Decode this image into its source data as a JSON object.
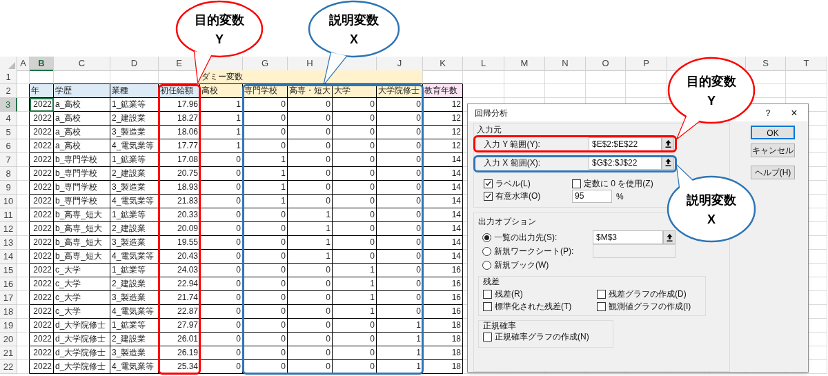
{
  "sheet": {
    "columns": [
      {
        "label": "A",
        "selected": false
      },
      {
        "label": "B",
        "selected": true
      },
      {
        "label": "C",
        "selected": false
      },
      {
        "label": "D",
        "selected": false
      },
      {
        "label": "E",
        "selected": false
      },
      {
        "selected": false
      },
      {
        "label": "G",
        "selected": false
      },
      {
        "label": "H",
        "selected": false
      },
      {
        "selected": false
      },
      {
        "label": "J",
        "selected": false
      },
      {
        "label": "K",
        "selected": false
      },
      {
        "label": "L",
        "selected": false
      },
      {
        "label": "M",
        "selected": false
      },
      {
        "label": "N",
        "selected": false
      },
      {
        "label": "O",
        "selected": false
      },
      {
        "label": "P",
        "selected": false
      },
      {
        "selected": false
      },
      {
        "selected": false
      },
      {
        "label": "S",
        "selected": false
      },
      {
        "label": "T",
        "selected": false
      }
    ],
    "rows": [
      {
        "number": "1",
        "selected": false
      },
      {
        "number": "2",
        "selected": false
      },
      {
        "number": "3",
        "selected": true
      },
      {
        "number": "4",
        "selected": false
      },
      {
        "number": "5",
        "selected": false
      },
      {
        "number": "6",
        "selected": false
      },
      {
        "number": "7",
        "selected": false
      },
      {
        "number": "8",
        "selected": false
      },
      {
        "number": "9",
        "selected": false
      },
      {
        "number": "10",
        "selected": false
      },
      {
        "number": "11",
        "selected": false
      },
      {
        "number": "12",
        "selected": false
      },
      {
        "number": "13",
        "selected": false
      },
      {
        "number": "14",
        "selected": false
      },
      {
        "number": "15",
        "selected": false
      },
      {
        "number": "16",
        "selected": false
      },
      {
        "number": "17",
        "selected": false
      },
      {
        "number": "18",
        "selected": false
      },
      {
        "number": "19",
        "selected": false
      },
      {
        "number": "20",
        "selected": false
      },
      {
        "number": "21",
        "selected": false
      },
      {
        "number": "22",
        "selected": false
      }
    ],
    "group_header": {
      "text": "ダミー変数",
      "color": "#fff2cc"
    },
    "headers": [
      {
        "text": "年",
        "color": "#ddebf7"
      },
      {
        "text": "学歴",
        "color": "#ddebf7"
      },
      {
        "text": "業種",
        "color": "#ddebf7"
      },
      {
        "text": "初任給額",
        "color": "#ddebf7"
      },
      {
        "text": "高校",
        "color": "#fff2cc"
      },
      {
        "text": "専門学校",
        "color": "#fff2cc"
      },
      {
        "text": "高専・短大",
        "color": "#fff2cc"
      },
      {
        "text": "大学",
        "color": "#fff2cc"
      },
      {
        "text": "大学院修士",
        "color": "#fff2cc"
      },
      {
        "text": "教育年数",
        "color": "#fce4f4"
      }
    ],
    "records": [
      [
        "2022",
        "a_高校",
        "1_鉱業等",
        "17.96",
        "1",
        "0",
        "0",
        "0",
        "0",
        "12"
      ],
      [
        "2022",
        "a_高校",
        "2_建設業",
        "18.27",
        "1",
        "0",
        "0",
        "0",
        "0",
        "12"
      ],
      [
        "2022",
        "a_高校",
        "3_製造業",
        "18.06",
        "1",
        "0",
        "0",
        "0",
        "0",
        "12"
      ],
      [
        "2022",
        "a_高校",
        "4_電気業等",
        "17.77",
        "1",
        "0",
        "0",
        "0",
        "0",
        "12"
      ],
      [
        "2022",
        "b_専門学校",
        "1_鉱業等",
        "17.08",
        "0",
        "1",
        "0",
        "0",
        "0",
        "14"
      ],
      [
        "2022",
        "b_専門学校",
        "2_建設業",
        "20.75",
        "0",
        "1",
        "0",
        "0",
        "0",
        "14"
      ],
      [
        "2022",
        "b_専門学校",
        "3_製造業",
        "18.93",
        "0",
        "1",
        "0",
        "0",
        "0",
        "14"
      ],
      [
        "2022",
        "b_専門学校",
        "4_電気業等",
        "21.83",
        "0",
        "1",
        "0",
        "0",
        "0",
        "14"
      ],
      [
        "2022",
        "b_高専_短大",
        "1_鉱業等",
        "20.33",
        "0",
        "0",
        "1",
        "0",
        "0",
        "14"
      ],
      [
        "2022",
        "b_高専_短大",
        "2_建設業",
        "20.09",
        "0",
        "0",
        "1",
        "0",
        "0",
        "14"
      ],
      [
        "2022",
        "b_高専_短大",
        "3_製造業",
        "19.55",
        "0",
        "0",
        "1",
        "0",
        "0",
        "14"
      ],
      [
        "2022",
        "b_高専_短大",
        "4_電気業等",
        "20.43",
        "0",
        "0",
        "1",
        "0",
        "0",
        "14"
      ],
      [
        "2022",
        "c_大学",
        "1_鉱業等",
        "24.03",
        "0",
        "0",
        "0",
        "1",
        "0",
        "16"
      ],
      [
        "2022",
        "c_大学",
        "2_建設業",
        "22.94",
        "0",
        "0",
        "0",
        "1",
        "0",
        "16"
      ],
      [
        "2022",
        "c_大学",
        "3_製造業",
        "21.74",
        "0",
        "0",
        "0",
        "1",
        "0",
        "16"
      ],
      [
        "2022",
        "c_大学",
        "4_電気業等",
        "22.87",
        "0",
        "0",
        "0",
        "1",
        "0",
        "16"
      ],
      [
        "2022",
        "d_大学院修士",
        "1_鉱業等",
        "27.97",
        "0",
        "0",
        "0",
        "0",
        "1",
        "18"
      ],
      [
        "2022",
        "d_大学院修士",
        "2_建設業",
        "26.01",
        "0",
        "0",
        "0",
        "0",
        "1",
        "18"
      ],
      [
        "2022",
        "d_大学院修士",
        "3_製造業",
        "26.19",
        "0",
        "0",
        "0",
        "0",
        "1",
        "18"
      ],
      [
        "2022",
        "d_大学院修士",
        "4_電気業等",
        "25.34",
        "0",
        "0",
        "0",
        "0",
        "1",
        "18"
      ]
    ]
  },
  "dialog": {
    "title": "回帰分析",
    "help": "?",
    "close": "×",
    "input_group": {
      "title": "入力元",
      "ranges": [
        {
          "label": "入力 Y 範囲(Y):",
          "value": "$E$2:$E$22"
        },
        {
          "label": "入力 X 範囲(X):",
          "value": "$G$2:$J$22"
        }
      ],
      "options": [
        {
          "label": "ラベル(L)",
          "checked": true
        },
        {
          "label": "定数に 0 を使用(Z)",
          "checked": false
        },
        {
          "label": "有意水準(O)",
          "checked": true
        }
      ],
      "confidence": {
        "value": "95",
        "unit": "%"
      }
    },
    "output_group": {
      "title": "出力オプション",
      "destinations": [
        {
          "label": "一覧の出力先(S):",
          "selected": true,
          "field": {
            "value": "$M$3",
            "disabled": false
          }
        },
        {
          "label": "新規ワークシート(P):",
          "selected": false,
          "field": {
            "disabled": true
          }
        },
        {
          "label": "新規ブック(W)",
          "selected": false
        }
      ],
      "residuals": {
        "title": "残差",
        "options": [
          {
            "label": "残差(R)",
            "checked": false
          },
          {
            "label": "残差グラフの作成(D)",
            "checked": false
          },
          {
            "label": "標準化された残差(T)",
            "checked": false
          },
          {
            "label": "観測値グラフの作成(I)",
            "checked": false
          }
        ]
      },
      "normal": {
        "title": "正規確率",
        "options": [
          {
            "label": "正規確率グラフの作成(N)",
            "checked": false
          }
        ]
      }
    },
    "buttons": [
      {
        "label": "OK",
        "default": true
      },
      {
        "label": "キャンセル",
        "default": false
      },
      {
        "label": "ヘルプ(H)",
        "default": false
      }
    ]
  },
  "callouts": [
    {
      "color": "#ff0000",
      "lines": [
        "目的変数",
        "Y"
      ]
    },
    {
      "color": "#2e75b6",
      "lines": [
        "説明変数",
        "X"
      ]
    },
    {
      "color": "#ff0000",
      "lines": [
        "目的変数",
        "Y"
      ]
    },
    {
      "color": "#2e75b6",
      "lines": [
        "説明変数",
        "X"
      ]
    }
  ]
}
